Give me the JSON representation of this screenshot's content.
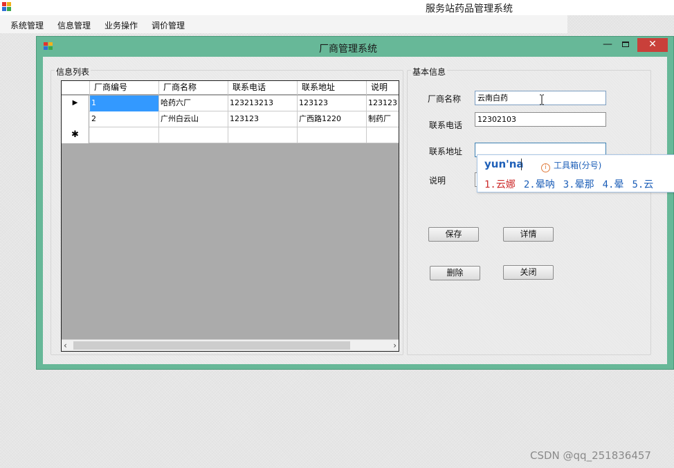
{
  "app": {
    "title": "服务站药品管理系统"
  },
  "menu": {
    "items": [
      "系统管理",
      "信息管理",
      "业务操作",
      "调价管理"
    ]
  },
  "child_window": {
    "title": "厂商管理系统",
    "minimize": "—",
    "close": "✕"
  },
  "list_group": {
    "title": "信息列表",
    "columns": [
      "厂商编号",
      "厂商名称",
      "联系电话",
      "联系地址",
      "说明"
    ],
    "rows": [
      [
        "1",
        "哈药六厂",
        "123213213",
        "123123",
        "123123"
      ],
      [
        "2",
        "广州白云山",
        "123123",
        "广西路1220",
        "制药厂"
      ]
    ],
    "current_row_marker": "▶",
    "new_row_marker": "✱",
    "scroll_left": "‹",
    "scroll_right": "›"
  },
  "info_group": {
    "title": "基本信息",
    "fields": {
      "name_label": "厂商名称",
      "name_value": "云南白药",
      "phone_label": "联系电话",
      "phone_value": "12302103",
      "address_label": "联系地址",
      "address_value": "",
      "note_label": "说明",
      "note_value": ""
    },
    "buttons": {
      "save": "保存",
      "detail": "详情",
      "delete": "删除",
      "close": "关闭"
    }
  },
  "ime": {
    "composition": "yun'na",
    "toolbox_icon": "i",
    "toolbox": "工具箱(分号)",
    "candidates": [
      "1.云娜",
      "2.晕呐",
      "3.晕那",
      "4.晕",
      "5.云"
    ]
  },
  "watermark": "CSDN @qq_251836457",
  "colors": {
    "window_frame": "#67b898",
    "close_button": "#c9403a",
    "selection": "#3399ff",
    "ime_text": "#1d5fb8"
  }
}
